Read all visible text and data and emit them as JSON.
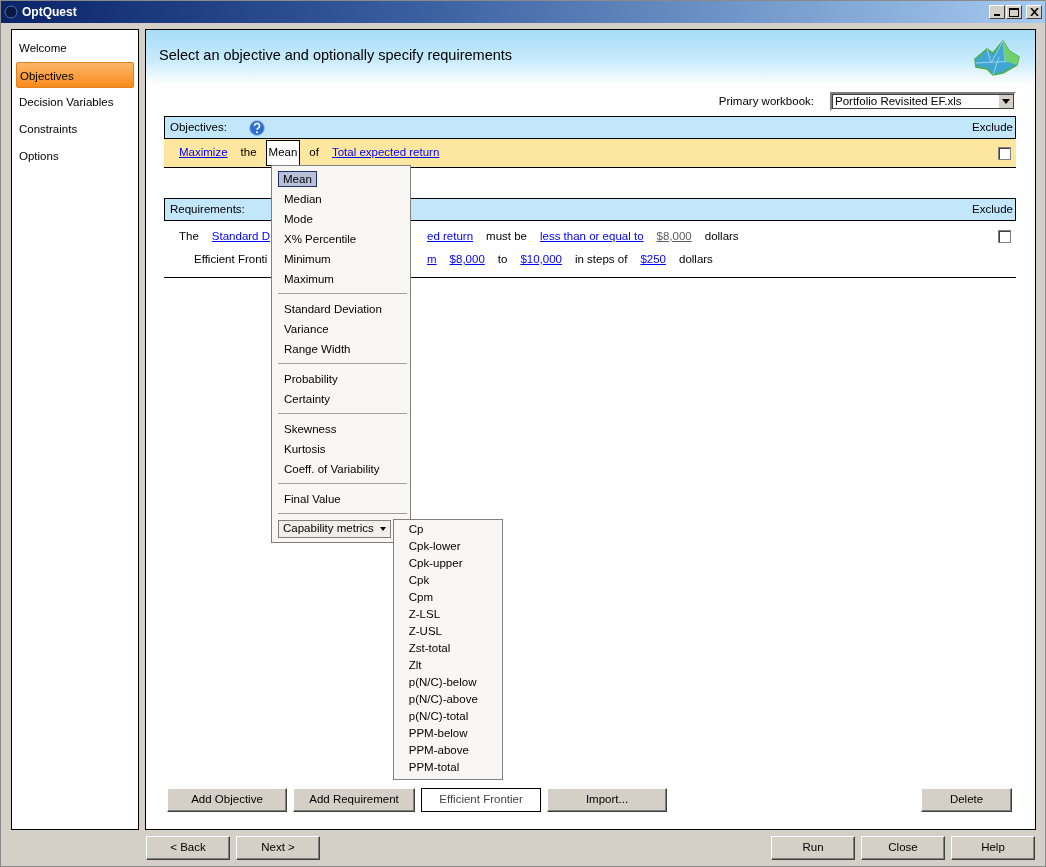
{
  "window": {
    "title": "OptQuest"
  },
  "sidebar": {
    "items": [
      {
        "label": "Welcome",
        "selected": false
      },
      {
        "label": "Objectives",
        "selected": true
      },
      {
        "label": "Decision Variables",
        "selected": false
      },
      {
        "label": "Constraints",
        "selected": false
      },
      {
        "label": "Options",
        "selected": false
      }
    ]
  },
  "header": {
    "title": "Select an objective and optionally specify requirements"
  },
  "workbook": {
    "label": "Primary workbook:",
    "value": "Portfolio Revisited EF.xls"
  },
  "objectives": {
    "heading": "Objectives:",
    "exclude_label": "Exclude",
    "rows": [
      {
        "highlighted": true,
        "excluded": false,
        "parts": [
          {
            "kind": "link",
            "text": "Maximize"
          },
          {
            "kind": "text",
            "text": "the"
          },
          {
            "kind": "field",
            "text": "Mean"
          },
          {
            "kind": "text",
            "text": "of"
          },
          {
            "kind": "link",
            "text": "Total expected return"
          }
        ]
      }
    ]
  },
  "requirements": {
    "heading": "Requirements:",
    "exclude_label": "Exclude",
    "rows": [
      {
        "kind": "requirement",
        "excluded": false,
        "parts": [
          {
            "kind": "text",
            "text": "The"
          },
          {
            "kind": "link",
            "text": "Standard D"
          },
          {
            "kind": "link",
            "text": "ed return"
          },
          {
            "kind": "text",
            "text": "must be"
          },
          {
            "kind": "link",
            "text": "less than or equal to"
          },
          {
            "kind": "value",
            "text": "$8,000"
          },
          {
            "kind": "text",
            "text": "dollars"
          }
        ]
      },
      {
        "kind": "frontier",
        "parts": [
          {
            "kind": "text",
            "text": "Efficient Fronti"
          },
          {
            "kind": "link",
            "text": "m"
          },
          {
            "kind": "link",
            "text": "$8,000"
          },
          {
            "kind": "text",
            "text": "to"
          },
          {
            "kind": "link",
            "text": "$10,000"
          },
          {
            "kind": "text",
            "text": "in steps of"
          },
          {
            "kind": "link",
            "text": "$250"
          },
          {
            "kind": "text",
            "text": "dollars"
          }
        ]
      }
    ]
  },
  "statistic_menu": {
    "groups": [
      [
        {
          "label": "Mean",
          "selected": true
        },
        {
          "label": "Median",
          "selected": false
        },
        {
          "label": "Mode",
          "selected": false
        },
        {
          "label": "X% Percentile",
          "selected": false
        },
        {
          "label": "Minimum",
          "selected": false
        },
        {
          "label": "Maximum",
          "selected": false
        }
      ],
      [
        {
          "label": "Standard Deviation",
          "selected": false
        },
        {
          "label": "Variance",
          "selected": false
        },
        {
          "label": "Range Width",
          "selected": false
        }
      ],
      [
        {
          "label": "Probability",
          "selected": false
        },
        {
          "label": "Certainty",
          "selected": false
        }
      ],
      [
        {
          "label": "Skewness",
          "selected": false
        },
        {
          "label": "Kurtosis",
          "selected": false
        },
        {
          "label": "Coeff. of Variability",
          "selected": false
        }
      ],
      [
        {
          "label": "Final Value",
          "selected": false
        }
      ]
    ],
    "submenu_button": "Capability metrics",
    "submenu_items": [
      "Cp",
      "Cpk-lower",
      "Cpk-upper",
      "Cpk",
      "Cpm",
      "Z-LSL",
      "Z-USL",
      "Zst-total",
      "Zlt",
      "p(N/C)-below",
      "p(N/C)-above",
      "p(N/C)-total",
      "PPM-below",
      "PPM-above",
      "PPM-total"
    ]
  },
  "panel_buttons": [
    {
      "label": "Add Objective",
      "disabled": false
    },
    {
      "label": "Add Requirement",
      "disabled": false
    },
    {
      "label": "Efficient Frontier",
      "disabled": true
    },
    {
      "label": "Import...",
      "disabled": false
    }
  ],
  "delete_button": "Delete",
  "nav_buttons": [
    "< Back",
    "Next >"
  ],
  "action_buttons": [
    "Run",
    "Close",
    "Help"
  ]
}
